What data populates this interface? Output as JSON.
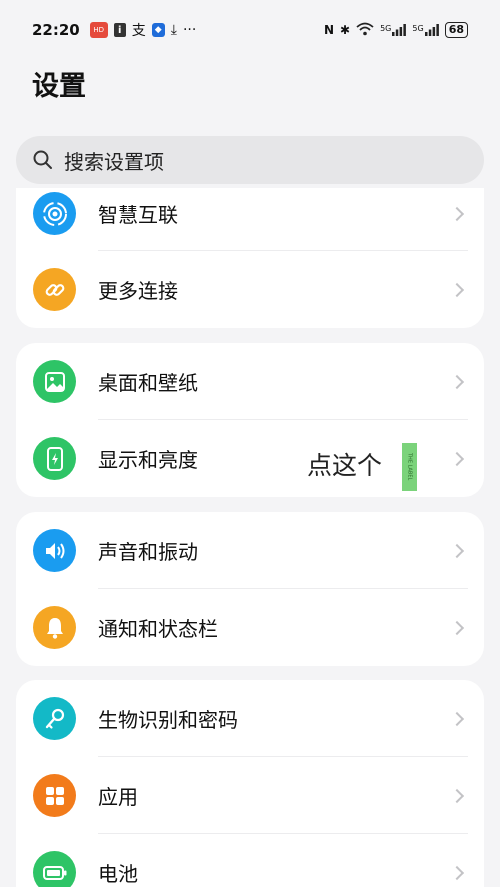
{
  "status_bar": {
    "time": "22:20",
    "badge_text": "HD",
    "notif_i": "i",
    "notif_char": "支",
    "battery": "68",
    "signal_5g_1": "5G",
    "signal_5g_2": "5G"
  },
  "page": {
    "title": "设置"
  },
  "search": {
    "placeholder": "搜索设置项"
  },
  "groups": [
    {
      "items": [
        {
          "label": "智慧互联",
          "icon": "smart-link-icon",
          "color": "#1a9cf0"
        },
        {
          "label": "更多连接",
          "icon": "link-icon",
          "color": "#f5a623"
        }
      ]
    },
    {
      "items": [
        {
          "label": "桌面和壁纸",
          "icon": "image-icon",
          "color": "#2ec466"
        },
        {
          "label": "显示和亮度",
          "icon": "display-icon",
          "color": "#2ec466"
        }
      ]
    },
    {
      "items": [
        {
          "label": "声音和振动",
          "icon": "speaker-icon",
          "color": "#1a9cf0"
        },
        {
          "label": "通知和状态栏",
          "icon": "bell-icon",
          "color": "#f5a623"
        }
      ]
    },
    {
      "items": [
        {
          "label": "生物识别和密码",
          "icon": "key-icon",
          "color": "#13b9c7"
        },
        {
          "label": "应用",
          "icon": "apps-icon",
          "color": "#f27b1b"
        },
        {
          "label": "电池",
          "icon": "battery-icon",
          "color": "#2ec466"
        }
      ]
    }
  ],
  "annotation": {
    "text": "点这个",
    "label_tag": "THE LABEL"
  }
}
